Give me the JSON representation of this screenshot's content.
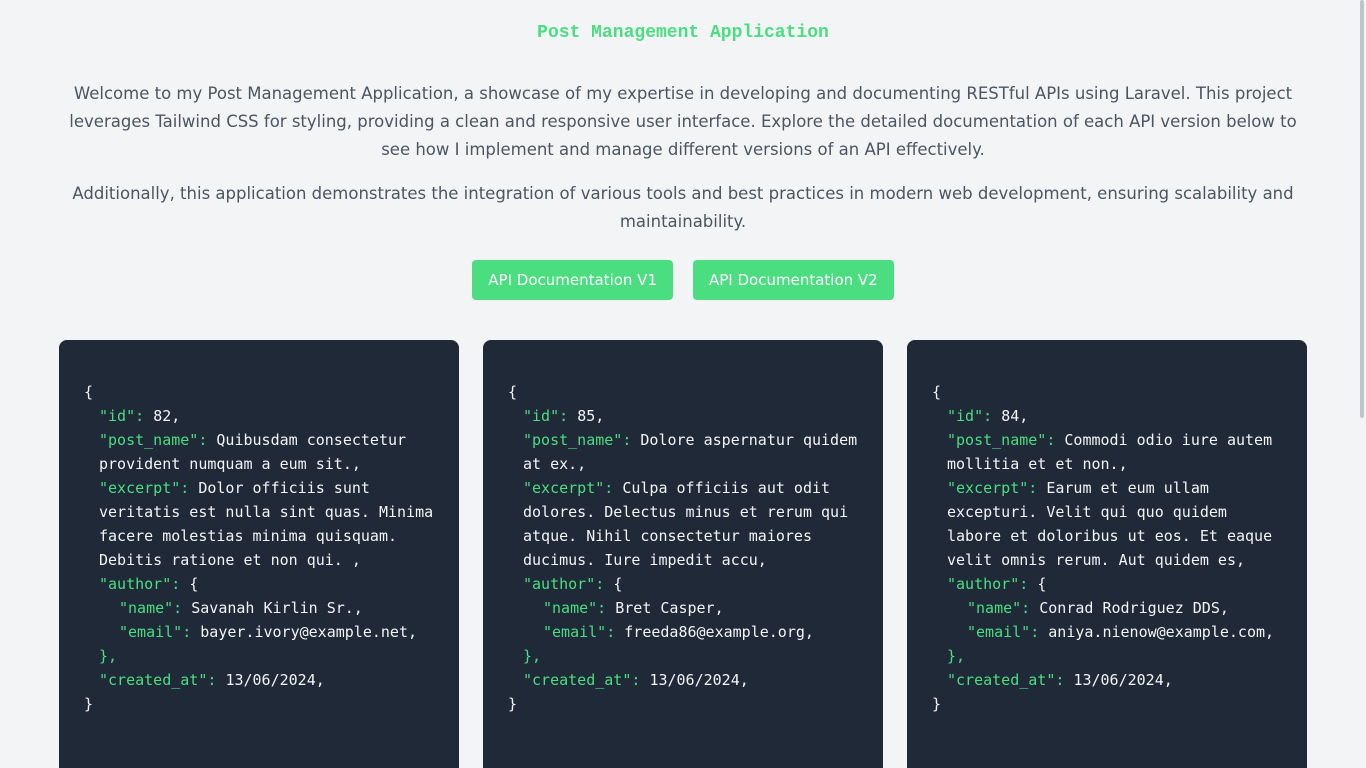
{
  "header": {
    "title": "Post Management Application"
  },
  "intro": {
    "paragraph1": "Welcome to my Post Management Application, a showcase of my expertise in developing and documenting RESTful APIs using Laravel. This project leverages Tailwind CSS for styling, providing a clean and responsive user interface. Explore the detailed documentation of each API version below to see how I implement and manage different versions of an API effectively.",
    "paragraph2": "Additionally, this application demonstrates the integration of various tools and best practices in modern web development, ensuring scalability and maintainability."
  },
  "buttons": {
    "v1_label": "API Documentation V1",
    "v2_label": "API Documentation V2"
  },
  "keys": {
    "open": "{",
    "close": "}",
    "id": "\"id\":",
    "post_name": "\"post_name\":",
    "excerpt": "\"excerpt\":",
    "author": "\"author\":",
    "author_open": "{",
    "name": "\"name\":",
    "email": "\"email\":",
    "author_close": "},",
    "created_at": "\"created_at\":"
  },
  "posts": [
    {
      "id": "82,",
      "post_name": "Quibusdam consectetur provident numquam a eum sit.,",
      "excerpt": "Dolor officiis sunt veritatis est nulla sint quas. Minima facere molestias minima quisquam. Debitis ratione et non qui. ,",
      "author_name": "Savanah Kirlin Sr.,",
      "author_email": "bayer.ivory@example.net,",
      "created_at": "13/06/2024,"
    },
    {
      "id": "85,",
      "post_name": "Dolore aspernatur quidem at ex.,",
      "excerpt": "Culpa officiis aut odit dolores. Delectus minus et rerum qui atque. Nihil consectetur maiores ducimus. Iure impedit accu,",
      "author_name": "Bret Casper,",
      "author_email": "freeda86@example.org,",
      "created_at": "13/06/2024,"
    },
    {
      "id": "84,",
      "post_name": "Commodi odio iure autem mollitia et et non.,",
      "excerpt": "Earum et eum ullam excepturi. Velit qui quo quidem labore et doloribus ut eos. Et eaque velit omnis rerum. Aut quidem es,",
      "author_name": "Conrad Rodriguez DDS,",
      "author_email": "aniya.nienow@example.com,",
      "created_at": "13/06/2024,"
    }
  ],
  "colors": {
    "accent": "#4ade80",
    "card_bg": "#1f2937",
    "page_bg": "#f3f4f6",
    "text_muted": "#4b5563"
  }
}
